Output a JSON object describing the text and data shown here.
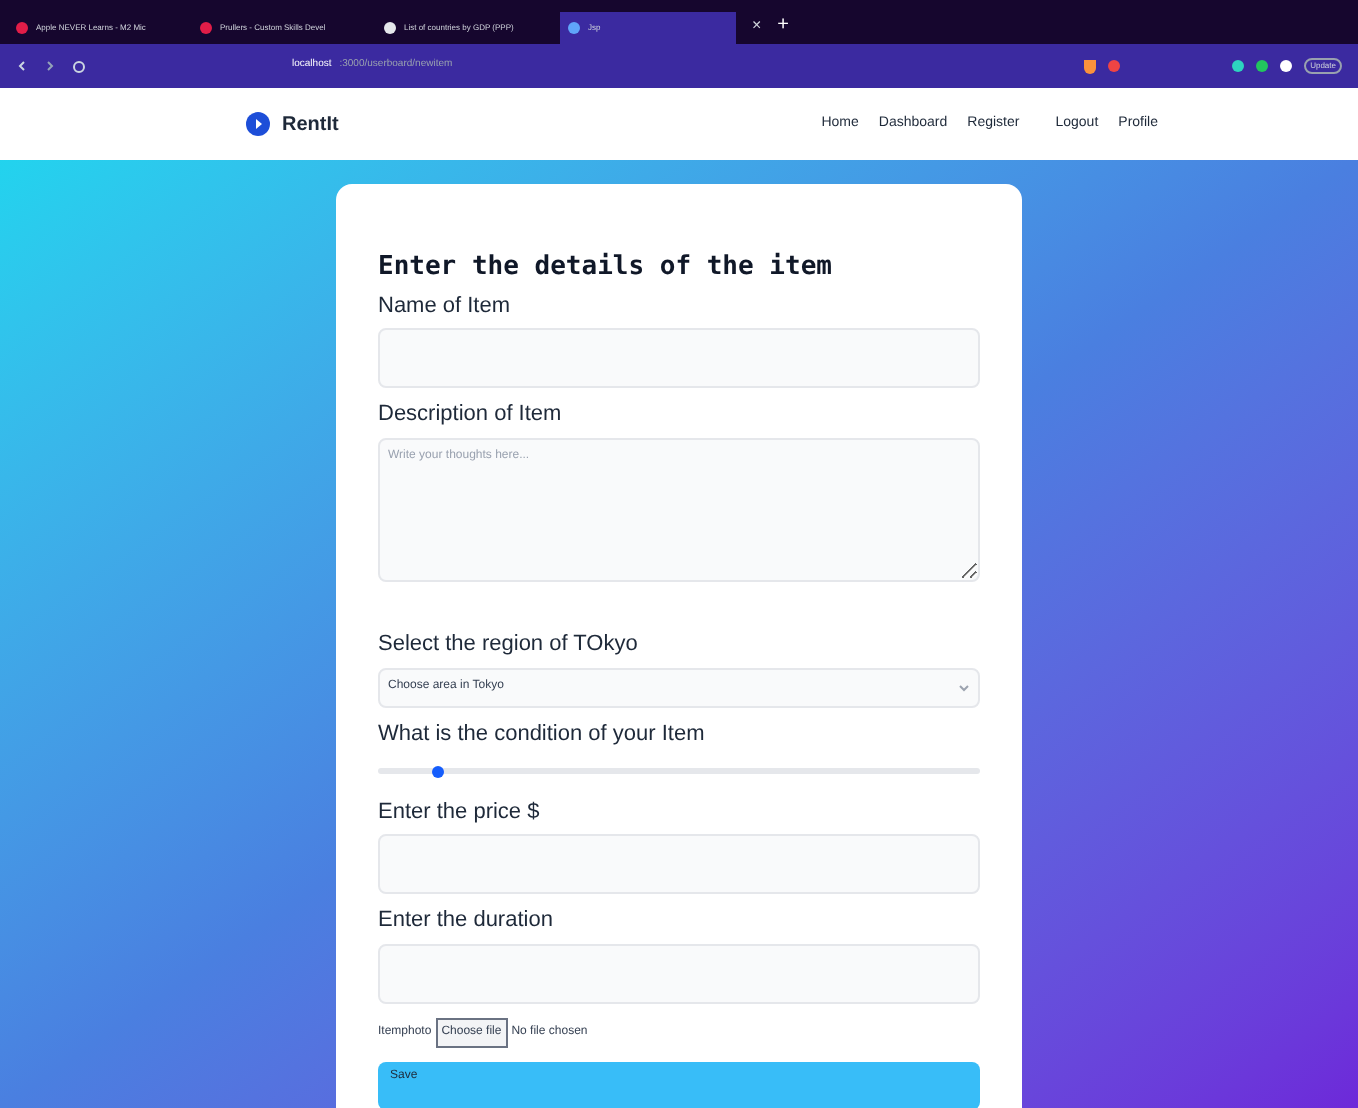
{
  "browser": {
    "tabs": [
      {
        "title": "Apple NEVER Learns - M2 Mic",
        "selected": false,
        "color": "#e11d48"
      },
      {
        "title": "Prullers - Custom Skills Devel",
        "selected": false,
        "color": "#e11d48"
      },
      {
        "title": "List of countries by GDP (PPP)",
        "selected": false,
        "color": "#e5e7eb"
      },
      {
        "title": "Jsp",
        "selected": true,
        "color": "#60a5fa"
      }
    ],
    "close_glyph": "×",
    "new_tab_glyph": "+",
    "url_host": "localhost",
    "url_path": ":3000/userboard/newitem",
    "update_label": "Update"
  },
  "navbar": {
    "brand": "RentIt",
    "links": [
      {
        "label": "Home"
      },
      {
        "label": "Dashboard"
      },
      {
        "label": "Register"
      },
      {
        "label": "Logout"
      },
      {
        "label": "Profile"
      }
    ]
  },
  "form": {
    "title": "Enter the details of the item",
    "fields": [
      {
        "kind": "text",
        "label": "Name of Item"
      },
      {
        "kind": "textarea",
        "label": "Description of Item",
        "placeholder": "Write your thoughts here..."
      },
      {
        "kind": "select",
        "label": "Select the region of TOkyo",
        "value": "Choose area in Tokyo"
      },
      {
        "kind": "slider",
        "label": "What is the condition of your Item",
        "level": 0.1
      },
      {
        "kind": "text",
        "label": "Enter the price $"
      },
      {
        "kind": "text",
        "label": "Enter the duration"
      },
      {
        "kind": "file",
        "label": "Itemphoto",
        "button": "Choose file",
        "status": "No file chosen"
      }
    ],
    "submit": "Save"
  }
}
